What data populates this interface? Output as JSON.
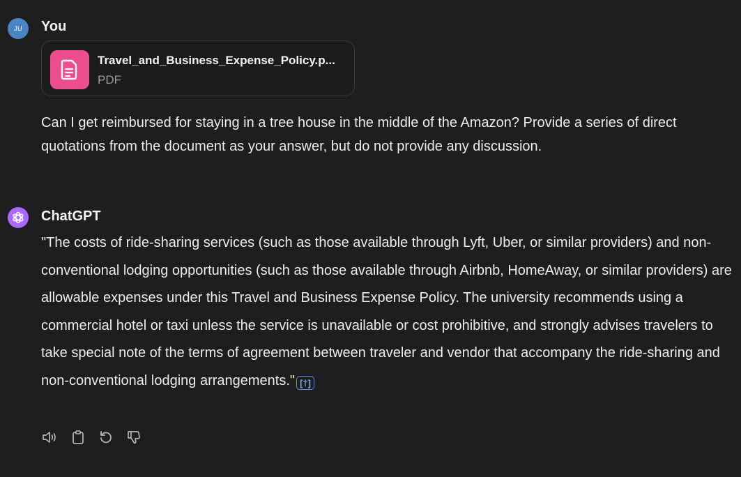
{
  "user": {
    "avatar_initials": "JU",
    "name": "You",
    "attachment": {
      "file_name": "Travel_and_Business_Expense_Policy.p...",
      "file_type": "PDF",
      "icon": "document-icon"
    },
    "message": "Can I get reimbursed for staying in a tree house in the middle of the Amazon? Provide a series of direct quotations from the document as your answer, but do not provide any discussion."
  },
  "assistant": {
    "name": "ChatGPT",
    "avatar_icon": "openai-logo-icon",
    "message": "\"The costs of ride-sharing services (such as those available through Lyft, Uber, or similar providers) and non-conventional lodging opportunities (such as those available through Airbnb, HomeAway, or similar providers) are allowable expenses under this Travel and Business Expense Policy. The university recommends using a commercial hotel or taxi unless the service is unavailable or cost prohibitive, and strongly advises travelers to take special note of the terms of agreement between traveler and vendor that accompany the ride-sharing and non-conventional lodging arrangements.\"",
    "citation_label": "[†]",
    "actions": [
      "read-aloud-icon",
      "copy-icon",
      "regenerate-icon",
      "thumbs-down-icon"
    ]
  },
  "colors": {
    "background": "#1e1e1f",
    "user_avatar": "#4a86c5",
    "assistant_avatar": "#ab68ff",
    "file_icon": "#ec4d8f",
    "citation": "#5b8fe6"
  }
}
